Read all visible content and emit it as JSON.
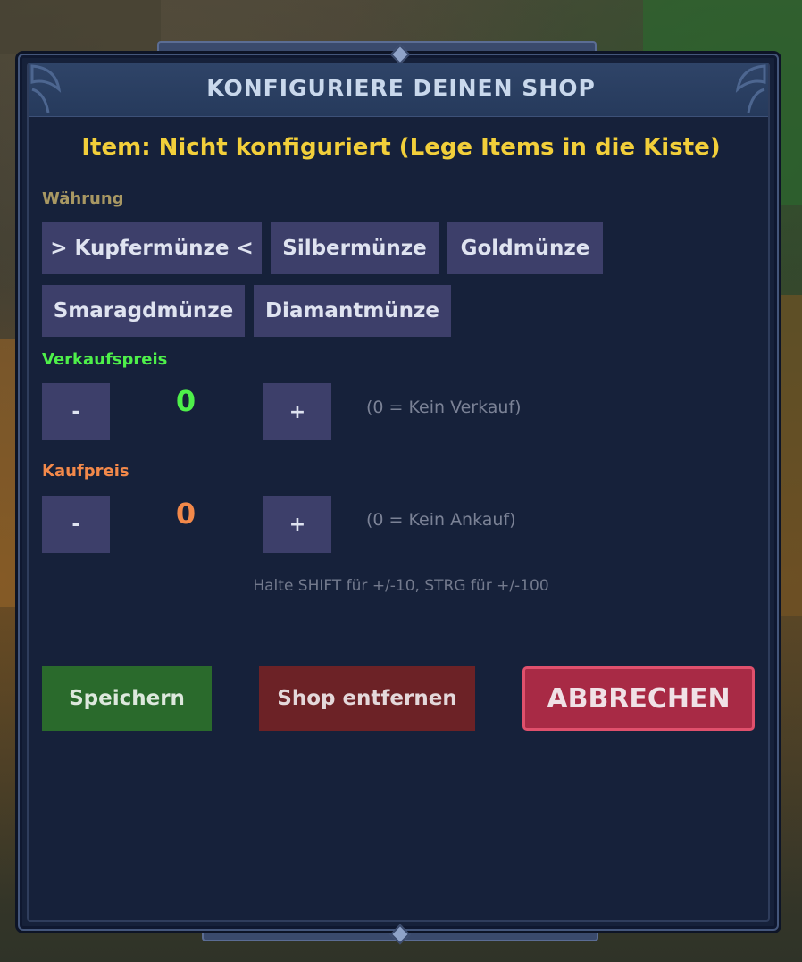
{
  "dialog": {
    "title": "KONFIGURIERE DEINEN SHOP",
    "item_line": "Item: Nicht konfiguriert (Lege Items in die Kiste)"
  },
  "currency": {
    "label": "Währung",
    "label_color": "#a89863",
    "options": [
      {
        "label": "> Kupfermünze <",
        "selected": true
      },
      {
        "label": "Silbermünze",
        "selected": false
      },
      {
        "label": "Goldmünze",
        "selected": false
      },
      {
        "label": "Smaragdmünze",
        "selected": false
      },
      {
        "label": "Diamantmünze",
        "selected": false
      }
    ]
  },
  "sell_price": {
    "label": "Verkaufspreis",
    "color": "#4ef04a",
    "minus": "-",
    "value": "0",
    "plus": "+",
    "hint": "(0 = Kein Verkauf)"
  },
  "buy_price": {
    "label": "Kaufpreis",
    "color": "#f3894a",
    "minus": "-",
    "value": "0",
    "plus": "+",
    "hint": "(0 = Kein Ankauf)"
  },
  "modifier_hint": "Halte SHIFT für +/-10, STRG für +/-100",
  "actions": {
    "save": "Speichern",
    "remove": "Shop entfernen",
    "cancel": "ABBRECHEN"
  },
  "colors": {
    "panel_bg": "#16213a",
    "header_bg": "#2f4468",
    "title_color": "#c9d8ec",
    "item_line_color": "#f2cf3a",
    "button_bg": "#3d3f6a",
    "save_bg": "#2a6a2c",
    "remove_bg": "#6c2226",
    "cancel_bg": "#a82a45"
  }
}
